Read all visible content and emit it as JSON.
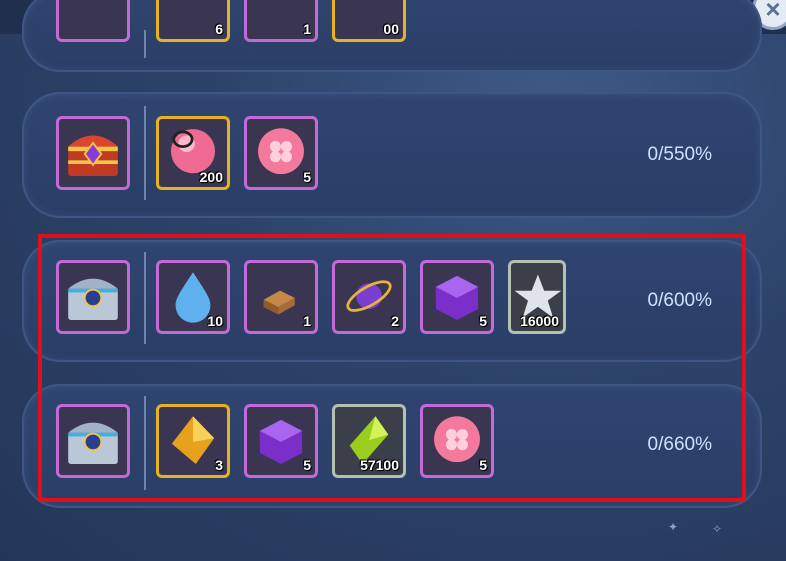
{
  "rows": [
    {
      "percent": "",
      "items": []
    },
    {
      "percent": "0/550%",
      "items": [
        {
          "qty": "200",
          "icon": "pink-orb-ring-icon"
        },
        {
          "qty": "5",
          "icon": "pink-clover-orb-icon"
        }
      ]
    },
    {
      "percent": "0/600%",
      "items": [
        {
          "qty": "10",
          "icon": "blue-droplet-icon"
        },
        {
          "qty": "1",
          "icon": "bronze-block-icon"
        },
        {
          "qty": "2",
          "icon": "armillary-sphere-icon"
        },
        {
          "qty": "5",
          "icon": "purple-cube-icon"
        },
        {
          "qty": "16000",
          "icon": "silver-star-icon"
        }
      ]
    },
    {
      "percent": "0/660%",
      "items": [
        {
          "qty": "3",
          "icon": "gold-crystal-icon"
        },
        {
          "qty": "5",
          "icon": "purple-cube-icon"
        },
        {
          "qty": "57100",
          "icon": "green-crystal-icon"
        },
        {
          "qty": "5",
          "icon": "pink-clover-orb-icon"
        }
      ]
    }
  ],
  "partial_row_qty": [
    "6",
    "1",
    "00"
  ],
  "colors": {
    "highlight": "#e0101a",
    "pink_frame": "#c46ad6",
    "gold_frame": "#e7b220"
  }
}
